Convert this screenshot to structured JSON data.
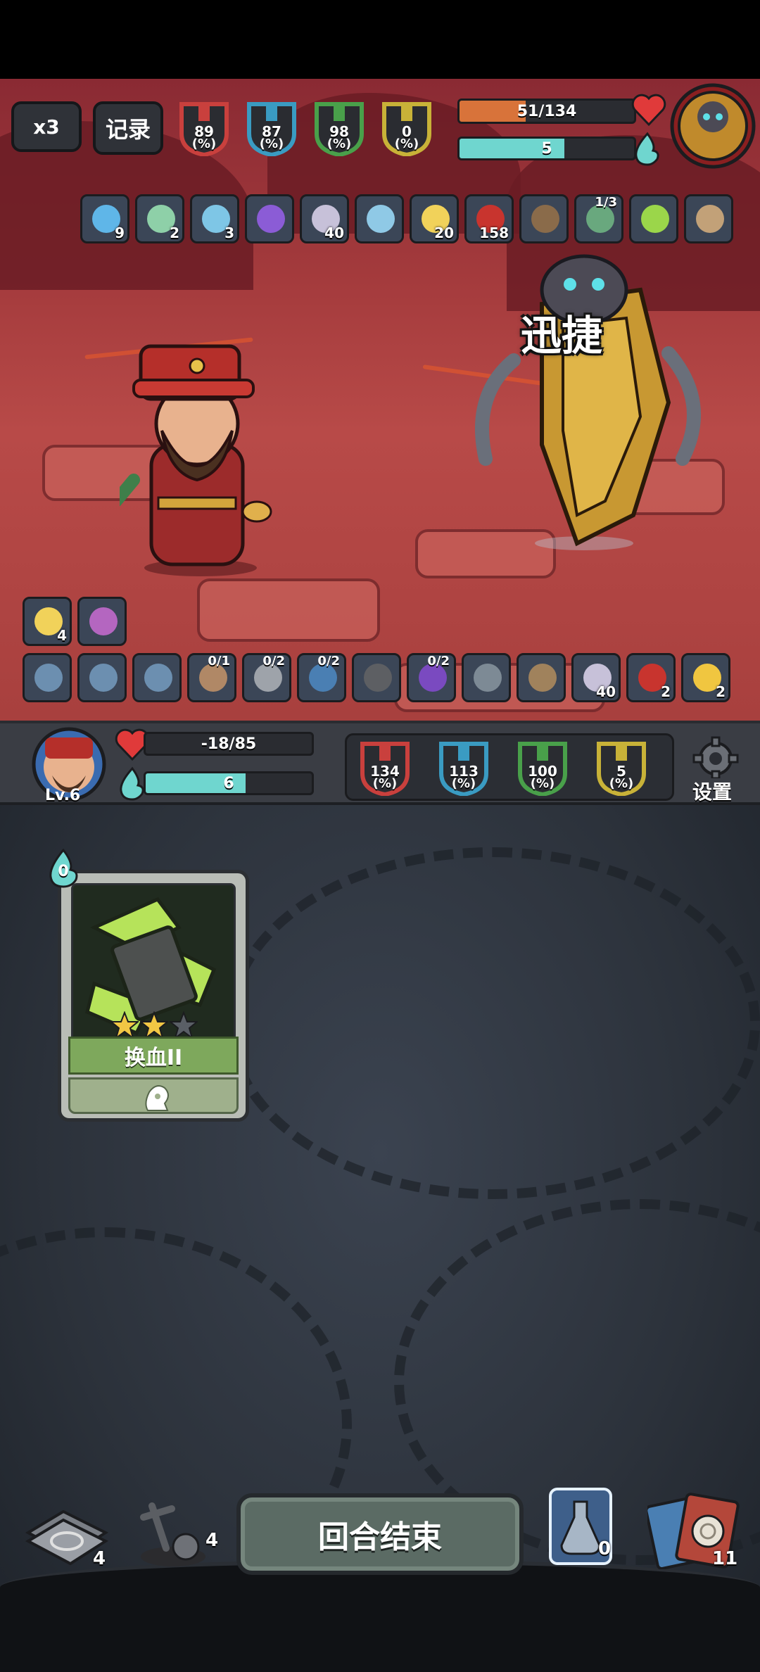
{
  "top_controls": {
    "speed_label": "x3",
    "record_label": "记录"
  },
  "enemy": {
    "hp_text": "51/134",
    "hp_fraction": 0.38,
    "energy_text": "5",
    "energy_fraction": 0.6,
    "stats": [
      {
        "value": "89",
        "unit": "(%)",
        "color": "#c9403d",
        "icon": "attack-down-icon"
      },
      {
        "value": "87",
        "unit": "(%)",
        "color": "#3a9bc2",
        "icon": "question-icon"
      },
      {
        "value": "98",
        "unit": "(%)",
        "color": "#49a04a",
        "icon": "defense-icon"
      },
      {
        "value": "0",
        "unit": "(%)",
        "color": "#c8b238",
        "icon": "crit-icon"
      }
    ],
    "buffs": [
      {
        "icon": "face-mask-icon",
        "count": "9",
        "frac": ""
      },
      {
        "icon": "wing-boot-icon",
        "count": "2",
        "frac": ""
      },
      {
        "icon": "ghost-icon",
        "count": "3",
        "frac": ""
      },
      {
        "icon": "purple-gem-icon",
        "count": "",
        "frac": ""
      },
      {
        "icon": "spiral-disc-icon",
        "count": "40",
        "frac": ""
      },
      {
        "icon": "tornado-icon",
        "count": "",
        "frac": ""
      },
      {
        "icon": "candle-icon",
        "count": "20",
        "frac": ""
      },
      {
        "icon": "claw-slash-icon",
        "count": "158",
        "frac": ""
      },
      {
        "icon": "book-icon",
        "count": "",
        "frac": ""
      },
      {
        "icon": "crystal-cube-icon",
        "count": "",
        "frac": "1/3"
      },
      {
        "icon": "green-shard-icon",
        "count": "",
        "frac": ""
      },
      {
        "icon": "orb-icon",
        "count": "",
        "frac": ""
      }
    ],
    "float_text": "迅捷"
  },
  "player_buffs_top": [
    {
      "icon": "candle-icon",
      "count": "4"
    },
    {
      "icon": "prism-gem-icon",
      "count": ""
    }
  ],
  "player_buffs": [
    {
      "icon": "fist-icon",
      "count": "",
      "frac": ""
    },
    {
      "icon": "staff-icon",
      "count": "",
      "frac": ""
    },
    {
      "icon": "paw-icon",
      "count": "",
      "frac": ""
    },
    {
      "icon": "bear-icon",
      "count": "",
      "frac": "0/1"
    },
    {
      "icon": "dagger-icon",
      "count": "",
      "frac": "0/2"
    },
    {
      "icon": "shield-crest-icon",
      "count": "",
      "frac": "0/2"
    },
    {
      "icon": "spiked-ball-icon",
      "count": "",
      "frac": ""
    },
    {
      "icon": "purple-banner-icon",
      "count": "",
      "frac": "0/2"
    },
    {
      "icon": "gear-orb-icon",
      "count": "",
      "frac": ""
    },
    {
      "icon": "gauntlet-icon",
      "count": "",
      "frac": ""
    },
    {
      "icon": "spiral-disc-icon",
      "count": "40",
      "frac": ""
    },
    {
      "icon": "claw-slash-icon",
      "count": "2",
      "frac": ""
    },
    {
      "icon": "clover-icon",
      "count": "2",
      "frac": ""
    }
  ],
  "player": {
    "level": "Lv.6",
    "hp_text": "-18/85",
    "hp_fraction": 0.0,
    "energy_text": "6",
    "energy_fraction": 0.6,
    "stats": [
      {
        "value": "134",
        "unit": "(%)",
        "color": "#c9403d",
        "icon": "attack-down-icon"
      },
      {
        "value": "113",
        "unit": "(%)",
        "color": "#3a9bc2",
        "icon": "question-icon"
      },
      {
        "value": "100",
        "unit": "(%)",
        "color": "#49a04a",
        "icon": "defense-icon"
      },
      {
        "value": "5",
        "unit": "(%)",
        "color": "#c8b238",
        "icon": "crit-icon"
      }
    ],
    "settings_label": "设置"
  },
  "hand": {
    "card": {
      "cost": "0",
      "name": "换血II",
      "stars_filled": 2,
      "stars_total": 3
    }
  },
  "bottom": {
    "draw_pile_count": "4",
    "grave_count": "4",
    "end_turn_label": "回合结束",
    "potion_count": "0",
    "deck_count": "11"
  },
  "colors": {
    "hp": "#d8733a",
    "energy": "#6fd6cf",
    "heart": "#e03a3a"
  }
}
